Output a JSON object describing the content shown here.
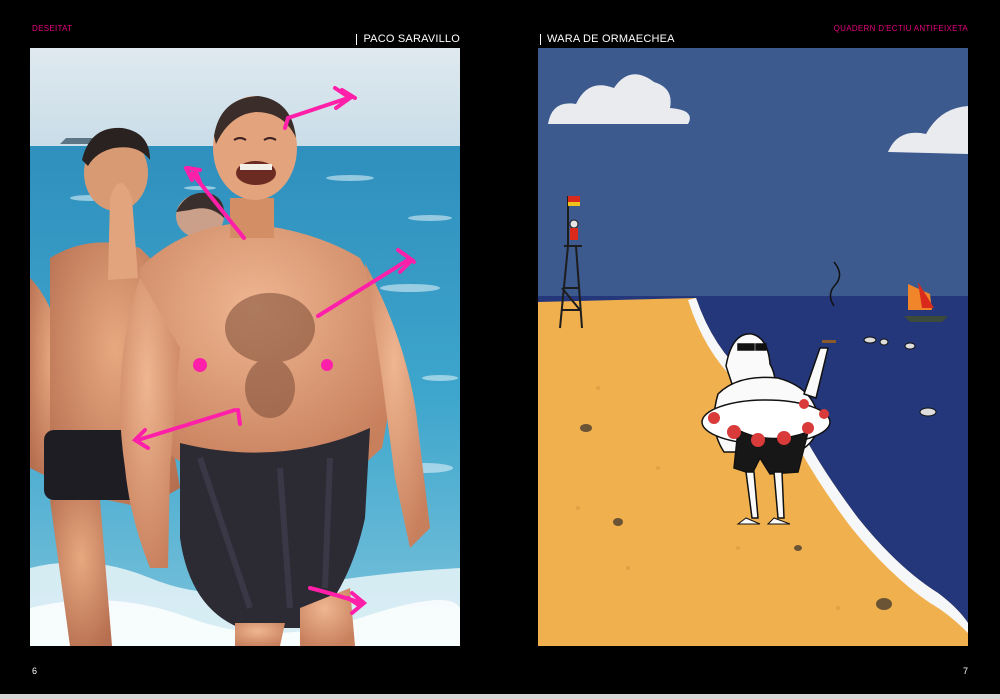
{
  "colors": {
    "page_background": "#000000",
    "section_tag": "#e6007e",
    "annotation_magenta": "#ff1fa8",
    "sky_blue": "#3d5a8f",
    "sea_blue": "#24377a",
    "sand": "#f0b04e",
    "photo_sea": "#3ea6cc"
  },
  "left_page": {
    "section_tag": "DESEITAT",
    "credit": "PACO SARAVILLO",
    "folio": "6"
  },
  "right_page": {
    "section_tag": "QUADERN D'ECTIU ANTIFEIXETA",
    "credit": "WARA DE ORMAECHEA",
    "folio": "7"
  }
}
